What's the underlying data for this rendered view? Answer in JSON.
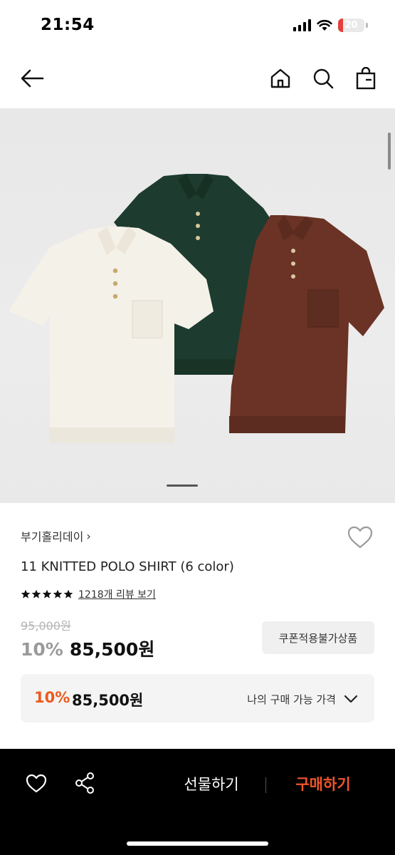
{
  "status_bar": {
    "time": "21:54",
    "battery": "20",
    "battery_level": 0.2
  },
  "nav": {
    "icons": [
      "back-arrow-icon",
      "home-icon",
      "search-icon",
      "shopping-bag-icon"
    ]
  },
  "product": {
    "image_alt": "Three knitted polo shirts in cream, dark green and brown",
    "image_pages": 1,
    "brand": "부기홀리데이",
    "brand_chevron": "›",
    "name": "11 KNITTED POLO SHIRT (6 color)",
    "rating_stars": 5,
    "review_link": "1218개 리뷰 보기",
    "original_price": "95,000원",
    "discount": "10%",
    "price": "85,500원",
    "coupon_label": "쿠폰적용불가상품"
  },
  "my_price": {
    "discount": "10%",
    "price": "85,500원",
    "label": "나의 구매 가능 가격"
  },
  "bottom_bar": {
    "gift_label": "선물하기",
    "buy_label": "구매하기"
  },
  "colors": {
    "accent_orange": "#f0552a",
    "discount_orange": "#ec5a1c",
    "battery_red": "#e4403a"
  }
}
